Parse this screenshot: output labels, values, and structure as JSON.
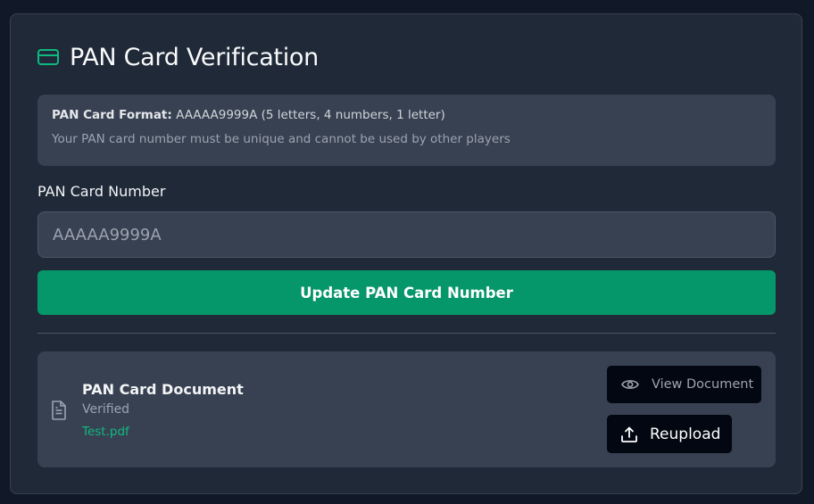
{
  "header": {
    "title": "PAN Card Verification",
    "icon": "credit-card-icon"
  },
  "info": {
    "format_label": "PAN Card Format:",
    "format_value": "AAAAA9999A (5 letters, 4 numbers, 1 letter)",
    "note": "Your PAN card number must be unique and cannot be used by other players"
  },
  "form": {
    "field_label": "PAN Card Number",
    "input_value": "",
    "input_placeholder": "AAAAA9999A",
    "submit_label": "Update PAN Card Number"
  },
  "document": {
    "icon": "file-text-icon",
    "title": "PAN Card Document",
    "status": "Verified",
    "file_name": "Test.pdf",
    "view_label": "View Document",
    "view_icon": "eye-icon",
    "reupload_label": "Reupload",
    "reupload_icon": "upload-icon"
  },
  "colors": {
    "accent": "#059669",
    "file_link": "#10b981",
    "background": "#111827",
    "card": "#1f2937",
    "panel": "#374151"
  }
}
